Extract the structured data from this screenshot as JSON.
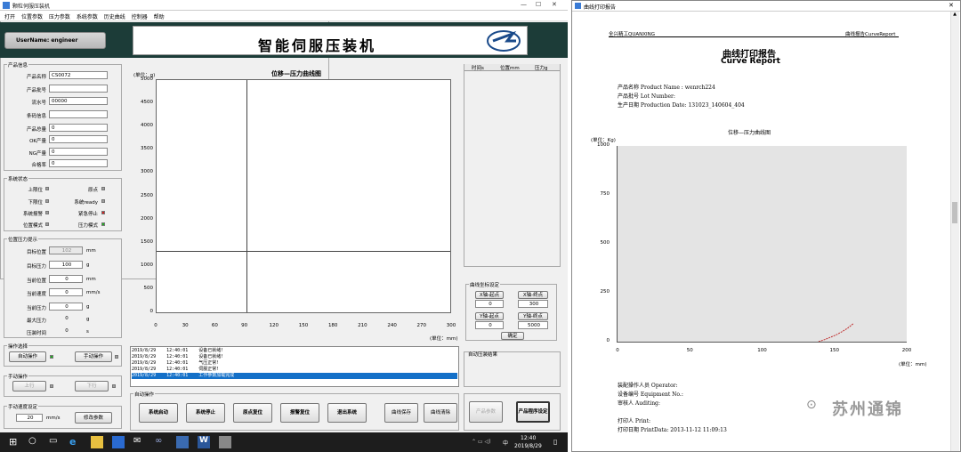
{
  "app": {
    "window_title": "颗粒伺服压装机",
    "menu": [
      "打开",
      "位置参数",
      "压力参数",
      "系统参数",
      "历史曲线",
      "控制器",
      "帮助"
    ],
    "user_label": "UserName: engineer",
    "banner_title": "智能伺服压装机",
    "product_info": {
      "title": "产品信息",
      "fields": [
        {
          "label": "产品名称",
          "value": "CS0072"
        },
        {
          "label": "产品批号",
          "value": ""
        },
        {
          "label": "流水号",
          "value": "00000"
        },
        {
          "label": "条码信息",
          "value": ""
        },
        {
          "label": "产品总量",
          "value": "0"
        },
        {
          "label": "OK产量",
          "value": "0"
        },
        {
          "label": "NG产量",
          "value": "0"
        },
        {
          "label": "合格率",
          "value": "0"
        }
      ]
    },
    "system_status": {
      "title": "系统状态",
      "items": [
        {
          "label": "上限位",
          "color": "#a0a0a0"
        },
        {
          "label": "原点",
          "color": "#a0a0a0"
        },
        {
          "label": "下限位",
          "color": "#a0a0a0"
        },
        {
          "label": "系统ready",
          "color": "#a0a0a0"
        },
        {
          "label": "系统报警",
          "color": "#a0a0a0"
        },
        {
          "label": "紧急停止",
          "color": "#d02020"
        },
        {
          "label": "位置模式",
          "color": "#a0a0a0"
        },
        {
          "label": "压力模式",
          "color": "#20b020"
        }
      ]
    },
    "position_pressure": {
      "title": "位置压力提示",
      "rows": [
        {
          "label": "目标位置",
          "value": "102",
          "unit": "mm"
        },
        {
          "label": "目标压力",
          "value": "100",
          "unit": "g"
        },
        {
          "label": "当前位置",
          "value": "0",
          "unit": "mm"
        },
        {
          "label": "当前速度",
          "value": "0",
          "unit": "mm/s"
        },
        {
          "label": "当前压力",
          "value": "0",
          "unit": "g"
        },
        {
          "label": "最大压力",
          "value": "0",
          "unit": "g"
        },
        {
          "label": "压装时间",
          "value": "0",
          "unit": "s"
        }
      ]
    },
    "operation_select": {
      "title": "操作选择",
      "auto": "自动操作",
      "manual": "手动操作"
    },
    "manual_op": {
      "title": "手动操作",
      "up": "上行",
      "down": "下行"
    },
    "manual_speed": {
      "title": "手动速度设定",
      "value": "20",
      "unit": "mm/s",
      "button": "修改参数"
    },
    "chart": {
      "title": "位移—压力曲线图",
      "ylabel": "(单位：g)",
      "xlabel": "(单位：mm)",
      "yticks": [
        "5000",
        "4500",
        "4000",
        "3500",
        "3000",
        "2500",
        "2000",
        "1500",
        "1000",
        "500",
        "0"
      ],
      "xticks": [
        "0",
        "30",
        "60",
        "90",
        "120",
        "150",
        "180",
        "210",
        "240",
        "270",
        "300"
      ]
    },
    "table_headers": [
      "时间s",
      "位置mm",
      "压力g"
    ],
    "curve_coords": {
      "title": "曲线坐标设定",
      "x_start_label": "X轴-起点",
      "x_start": "0",
      "x_end_label": "X轴-终点",
      "x_end": "300",
      "y_start_label": "Y轴-起点",
      "y_start": "0",
      "y_end_label": "Y轴-终点",
      "y_end": "5000",
      "confirm": "确定"
    },
    "auto_result": {
      "title": "自动压装结果"
    },
    "log": [
      "2019/8/29    12:40:01    设备已就绪!",
      "2019/8/29    12:40:01    设备已就绪!",
      "2019/8/29    12:40:01    气压正常!",
      "2019/8/29    12:40:01    伺服正常!",
      "2019/8/29    12:40:01    工作参数加载完成"
    ],
    "auto_op": {
      "title": "自动操作",
      "buttons": [
        "系统启动",
        "系统停止",
        "原点复位",
        "报警复位",
        "退出系统",
        "曲线保存",
        "曲线清除"
      ]
    },
    "right_buttons": [
      "产品参数",
      "产品程序设定"
    ],
    "taskbar": {
      "time": "12:40",
      "date": "2019/8/29",
      "lang": "中"
    }
  },
  "report": {
    "window_title": "曲线打印报告",
    "header_left": "全兴精工QUANXING",
    "header_right": "曲线报告CurveReport",
    "title_cn": "曲线打印报告",
    "title_en": "Curve Report",
    "product_name": "产品名称 Product Name :    wenrch224",
    "lot_number": "产品批号 Lot Number:",
    "production_date": "生产日期 Production Date:     131023_140604_404",
    "chart_title": "位移—压力曲线图",
    "ylabel": "(单位：Kg)",
    "xlabel": "(单位：mm)",
    "operator": "装配操作人员 Operator:",
    "equipment": "设备编号 Equipment No.:",
    "auditing": "审核人 Auditing:",
    "printer": "打印人 Print:",
    "print_date": "打印日期 PrintData:     2013-11-12   11:09:13",
    "watermark": "苏州通锦"
  },
  "chart_data": {
    "type": "line",
    "title": "位移—压力曲线图",
    "xlabel": "(单位：mm)",
    "ylabel": "(单位：Kg)",
    "xlim": [
      0,
      200
    ],
    "ylim": [
      0,
      1000
    ],
    "xticks": [
      0,
      50,
      100,
      150,
      200
    ],
    "yticks": [
      0,
      250,
      500,
      750,
      1000
    ],
    "series": [
      {
        "color": "#c03030",
        "x": [
          139,
          143,
          147,
          151,
          155,
          159,
          163
        ],
        "y": [
          0,
          10,
          22,
          34,
          50,
          68,
          92
        ]
      }
    ]
  }
}
